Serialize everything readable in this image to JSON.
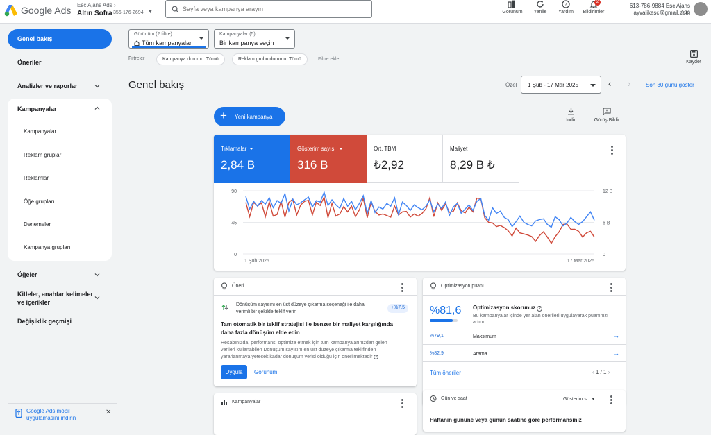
{
  "header": {
    "brand": "Google Ads",
    "account_manager": "Esc Ajans Ads",
    "account_name": "Altın Sofra",
    "account_id": "356-176-2694",
    "search_placeholder": "Sayfa veya kampanya arayın",
    "tools": {
      "appearance": "Görünüm",
      "refresh": "Yenile",
      "help": "Yardım",
      "notifications": "Bildirimler",
      "notifications_count": "2"
    },
    "user_id": "613-786-9884 Esc Ajans Ads",
    "user_email": "ayvalikesc@gmail.com"
  },
  "sidebar": {
    "overview": "Genel bakış",
    "recommendations": "Öneriler",
    "insights": "Analizler ve raporlar",
    "campaigns": "Kampanyalar",
    "campaigns_sub": {
      "campaigns": "Kampanyalar",
      "ad_groups": "Reklam grupları",
      "ads": "Reklamlar",
      "asset_groups": "Öğe grupları",
      "experiments": "Denemeler",
      "campaign_groups": "Kampanya grupları"
    },
    "assets": "Öğeler",
    "audiences_line1": "Kitleler, anahtar kelimeler",
    "audiences_line2": "ve içerikler",
    "change_history": "Değişiklik geçmişi",
    "mobile_promo_line1": "Google Ads mobil",
    "mobile_promo_line2": "uygulamasını indirin"
  },
  "filters": {
    "view_label": "Görünüm (2 filtre)",
    "view_value": "Tüm kampanyalar",
    "campaigns_label": "Kampanyalar (5)",
    "campaigns_value": "Bir kampanya seçin",
    "filters_label": "Filtreler",
    "chip_campaign_status": "Kampanya durumu: Tümü",
    "chip_adgroup_status": "Reklam grubu durumu: Tümü",
    "add_filter": "Filtre ekle",
    "save": "Kaydet"
  },
  "page": {
    "title": "Genel bakış",
    "date_type": "Özel",
    "date_range": "1 Şub - 17 Mar 2025",
    "last_30": "Son 30 günü göster",
    "new_campaign": "Yeni kampanya",
    "download": "İndir",
    "feedback": "Görüş Bildir"
  },
  "metrics": [
    {
      "name": "Tıklamalar",
      "value": "2,84 B"
    },
    {
      "name": "Gösterim sayısı",
      "value": "316 B"
    },
    {
      "name": "Ort. TBM",
      "value": "₺2,92"
    },
    {
      "name": "Maliyet",
      "value": "8,29 B ₺"
    }
  ],
  "chart_data": {
    "type": "line",
    "x_start_label": "1 Şub 2025",
    "x_end_label": "17 Mar 2025",
    "left_axis_ticks": [
      "90",
      "45",
      "0"
    ],
    "right_axis_ticks": [
      "12 B",
      "6 B",
      "0"
    ],
    "ylim_left": [
      0,
      90
    ],
    "ylim_right": [
      0,
      12000
    ],
    "colors": {
      "clicks": "#4285f4",
      "impressions": "#d04a3a"
    },
    "series": [
      {
        "name": "Tıklamalar",
        "axis": "left",
        "values": [
          82,
          64,
          75,
          68,
          76,
          71,
          80,
          66,
          76,
          72,
          86,
          61,
          78,
          70,
          73,
          77,
          81,
          67,
          76,
          74,
          88,
          69,
          77,
          70,
          65,
          79,
          68,
          75,
          63,
          72,
          83,
          58,
          76,
          59,
          67,
          64,
          72,
          68,
          80,
          56,
          74,
          69,
          62,
          70,
          66,
          63,
          68,
          77,
          60,
          71,
          65,
          74,
          55,
          67,
          72,
          58,
          64,
          70,
          62,
          75,
          79,
          55,
          48,
          66,
          58,
          61,
          52,
          49,
          39,
          46,
          54,
          45,
          42,
          40,
          47,
          49,
          50,
          42,
          38,
          53,
          49,
          40,
          44,
          52,
          46,
          42,
          46,
          53,
          60,
          48
        ]
      },
      {
        "name": "Gösterim sayısı",
        "axis": "right",
        "values": [
          9.8,
          7.1,
          9.8,
          9.1,
          9.7,
          7.1,
          9.9,
          7.2,
          7.5,
          10.0,
          7.0,
          9.8,
          10.4,
          7.4,
          9.3,
          10.0,
          10.2,
          7.4,
          9.8,
          9.2,
          10.8,
          6.9,
          9.6,
          7.2,
          7.6,
          9.0,
          8.0,
          9.1,
          7.1,
          8.4,
          10.6,
          6.9,
          9.8,
          8.1,
          7.4,
          7.6,
          7.3,
          7.0,
          9.1,
          7.4,
          8.0,
          8.1,
          7.0,
          7.6,
          7.2,
          7.7,
          8.6,
          10.7,
          7.1,
          9.7,
          8.3,
          9.5,
          7.9,
          8.1,
          9.7,
          8.2,
          7.8,
          8.9,
          8.0,
          10.6,
          10.5,
          6.9,
          6.0,
          5.9,
          5.2,
          5.4,
          5.0,
          4.4,
          3.4,
          4.9,
          4.0,
          3.8,
          3.6,
          3.3,
          2.4,
          3.5,
          4.2,
          3.2,
          2.0,
          3.3,
          4.2,
          5.6,
          5.7,
          4.7,
          4.7,
          4.3,
          3.2,
          4.0,
          4.3,
          3.2
        ]
      }
    ]
  },
  "recommendation_card": {
    "title": "Öneri",
    "hint": "Dönüşüm sayısını en üst düzeye çıkarma seçeneği ile daha verimli bir şekilde teklif verin",
    "badge": "+%7,5",
    "headline": "Tam otomatik bir teklif stratejisi ile benzer bir maliyet karşılığında daha fazla dönüşüm elde edin",
    "body": "Hesabınızda, performansı optimize etmek için tüm kampanyalarınızdan gelen verileri kullanabilen Dönüşüm sayısını en üst düzeye çıkarma teklifinden yararlanmaya yetecek kadar dönüşüm verisi olduğu için önerilmektedir",
    "apply": "Uygula",
    "view": "Görünüm"
  },
  "optimization_card": {
    "title": "Optimizasyon puanı",
    "score": "%81,6",
    "score_fraction": 0.816,
    "heading": "Optimizasyon skorunuz",
    "desc": "Bu kampanyalar içinde yer alan önerileri uygulayarak puanınızı artırın",
    "rows": [
      {
        "score": "%79,1",
        "name": "Maksimum"
      },
      {
        "score": "%82,9",
        "name": "Arama"
      }
    ],
    "all_recs": "Tüm öneriler",
    "pager": "1 / 1"
  },
  "campaigns_card": {
    "title": "Kampanyalar"
  },
  "daytime_card": {
    "title": "Gün ve saat",
    "metric": "Gösterim s...",
    "subtitle": "Haftanın gününe veya günün saatine göre performansınız"
  }
}
